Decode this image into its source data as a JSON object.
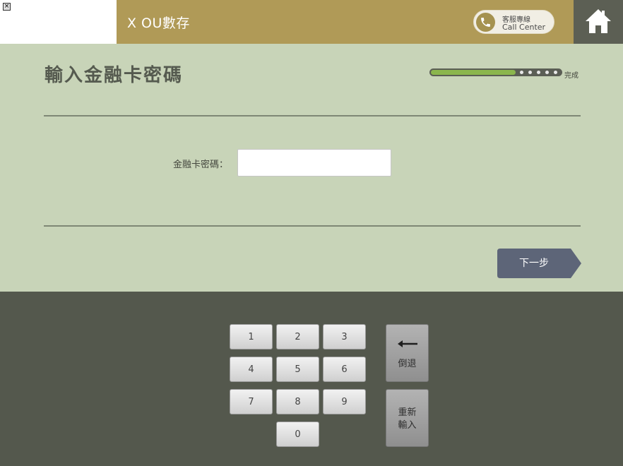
{
  "header": {
    "app_title": "X OU數存",
    "call_center_zh": "客服專線",
    "call_center_en": "Call Center"
  },
  "icons": {
    "phone": "phone-icon",
    "home": "home-icon",
    "close": "close-icon"
  },
  "main": {
    "title": "輸入金融卡密碼",
    "progress_label": "完成",
    "progress_value": 0.65,
    "field_label": "金融卡密碼：",
    "pin_value": "",
    "next_label": "下一步"
  },
  "keypad": {
    "keys": [
      "1",
      "2",
      "3",
      "4",
      "5",
      "6",
      "7",
      "8",
      "9",
      "0"
    ],
    "backspace_label": "倒退",
    "reset_label_line1": "重新",
    "reset_label_line2": "輸入"
  },
  "colors": {
    "header_gold": "#b09a57",
    "main_bg": "#c8d4b8",
    "keypad_bg": "#54584d",
    "next_button": "#5d6578",
    "progress_fill": "#8bb64d"
  }
}
